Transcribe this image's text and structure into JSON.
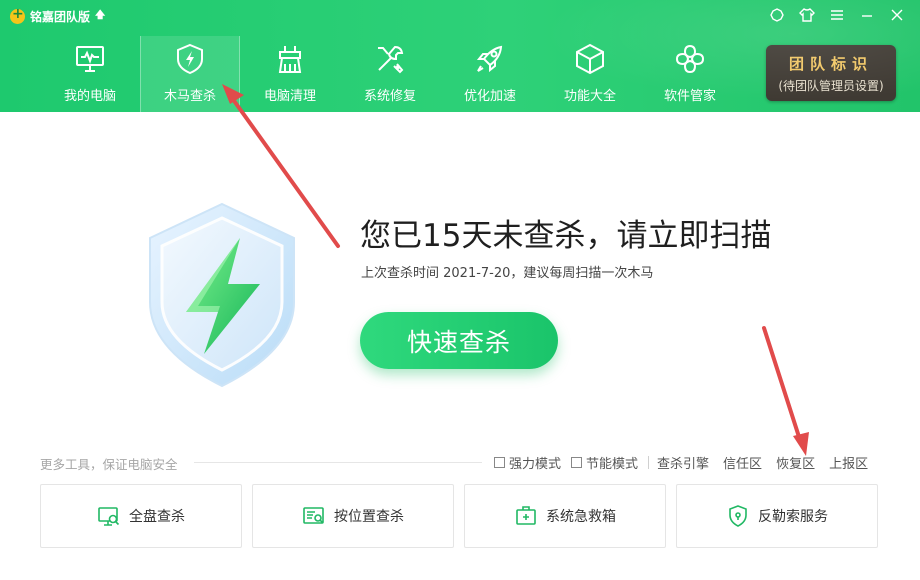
{
  "app": {
    "title": "铭嘉团队版",
    "upgrade_icon": "arrow-up-icon"
  },
  "window_controls": [
    {
      "name": "skin-icon"
    },
    {
      "name": "shirt-icon"
    },
    {
      "name": "menu-icon"
    },
    {
      "name": "minimize-icon"
    },
    {
      "name": "close-icon"
    }
  ],
  "nav": {
    "items": [
      {
        "label": "我的电脑",
        "icon": "monitor-icon",
        "active": false
      },
      {
        "label": "木马查杀",
        "icon": "shield-bolt-icon",
        "active": true
      },
      {
        "label": "电脑清理",
        "icon": "broom-icon",
        "active": false
      },
      {
        "label": "系统修复",
        "icon": "wrench-icon",
        "active": false
      },
      {
        "label": "优化加速",
        "icon": "rocket-icon",
        "active": false
      },
      {
        "label": "功能大全",
        "icon": "cube-icon",
        "active": false
      },
      {
        "label": "软件管家",
        "icon": "apps-icon",
        "active": false
      }
    ]
  },
  "team_badge": {
    "title": "团队标识",
    "subtitle": "(待团队管理员设置)"
  },
  "main": {
    "headline": "您已15天未查杀，请立即扫描",
    "subline": "上次查杀时间 2021-7-20，建议每周扫描一次木马",
    "scan_button": "快速查杀"
  },
  "tools": {
    "label": "更多工具，保证电脑安全",
    "options": [
      {
        "label": "强力模式",
        "checked": false
      },
      {
        "label": "节能模式",
        "checked": false
      }
    ],
    "links": [
      "查杀引擎",
      "信任区",
      "恢复区",
      "上报区"
    ],
    "cards": [
      {
        "label": "全盘查杀",
        "icon": "disk-scan-icon"
      },
      {
        "label": "按位置查杀",
        "icon": "location-scan-icon"
      },
      {
        "label": "系统急救箱",
        "icon": "first-aid-icon"
      },
      {
        "label": "反勒索服务",
        "icon": "shield-lock-icon"
      }
    ]
  },
  "colors": {
    "header": "#2ed178",
    "accent": "#1ec96e",
    "badge_bg": "#3f3a33",
    "badge_text": "#f2c866",
    "annotation_arrow": "#e14b4b"
  }
}
